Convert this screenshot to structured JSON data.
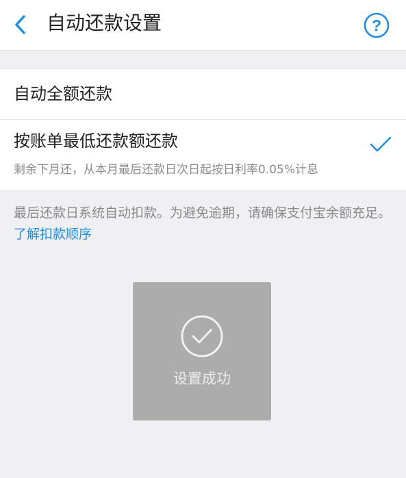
{
  "header": {
    "title": "自动还款设置",
    "back_icon": "chevron-left-icon",
    "help_icon": "question-circle-icon"
  },
  "options": [
    {
      "label": "自动全额还款",
      "selected": false
    },
    {
      "label": "按账单最低还款额还款",
      "description": "剩余下月还，从本月最后还款日次日起按日利率0.05%计息",
      "selected": true
    }
  ],
  "notice": {
    "text": "最后还款日系统自动扣款。为避免逾期，请确保支付宝余额充足。",
    "link_text": "了解扣款顺序"
  },
  "toast": {
    "icon": "check-circle-icon",
    "text": "设置成功"
  },
  "colors": {
    "accent": "#1f8ee6",
    "background": "#efeff4",
    "text_primary": "#222222",
    "text_secondary": "#8a8a8a",
    "toast_bg": "#a0a0a0"
  }
}
